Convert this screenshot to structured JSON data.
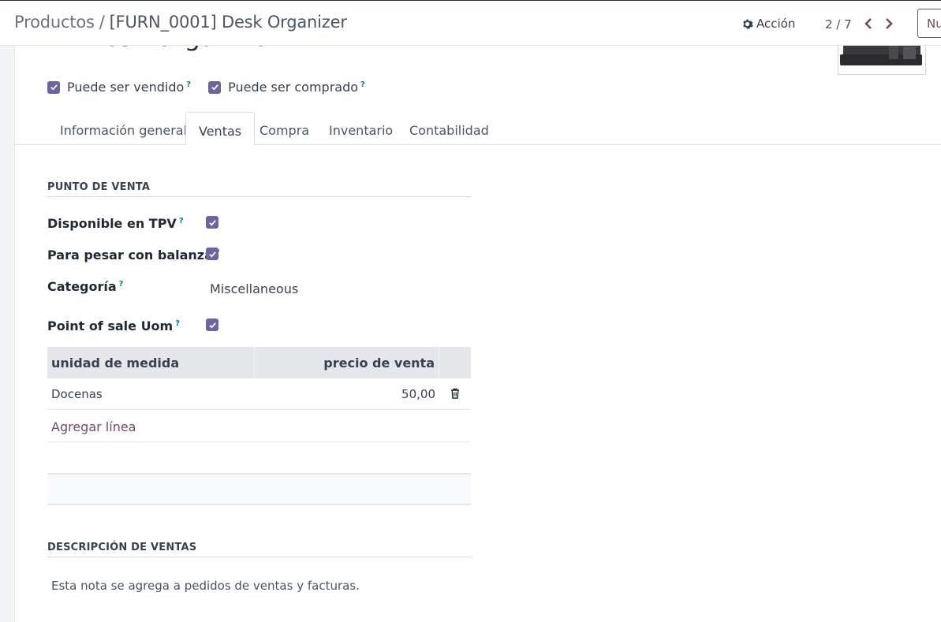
{
  "breadcrumb": {
    "parent": "Productos",
    "separator": "/",
    "current": "[FURN_0001] Desk Organizer"
  },
  "control_panel": {
    "action_label": "Acción",
    "pager": "2 / 7",
    "new_label": "Nu"
  },
  "product": {
    "name": "Desk Organizer",
    "can_be_sold_label": "Puede ser vendido",
    "can_be_purchased_label": "Puede ser comprado",
    "help_mark": "?"
  },
  "tabs": [
    {
      "label": "Información general"
    },
    {
      "label": "Ventas"
    },
    {
      "label": "Compra"
    },
    {
      "label": "Inventario"
    },
    {
      "label": "Contabilidad"
    }
  ],
  "pos_section": {
    "title": "PUNTO DE VENTA",
    "available_in_pos": "Disponible en TPV",
    "to_weight": "Para pesar con balanza",
    "category_label": "Categoría",
    "category_value": "Miscellaneous",
    "pos_uom": "Point of sale Uom"
  },
  "uom_table": {
    "headers": {
      "uom": "unidad de medida",
      "price": "precio de venta"
    },
    "rows": [
      {
        "uom": "Docenas",
        "price": "50,00"
      }
    ],
    "add_line": "Agregar línea"
  },
  "sales_description": {
    "title": "DESCRIPCIÓN DE VENTAS",
    "placeholder": "Esta nota se agrega a pedidos de ventas y facturas."
  },
  "colors": {
    "checkbox": "#71639e",
    "primary": "#714b67",
    "help": "#017e84"
  }
}
